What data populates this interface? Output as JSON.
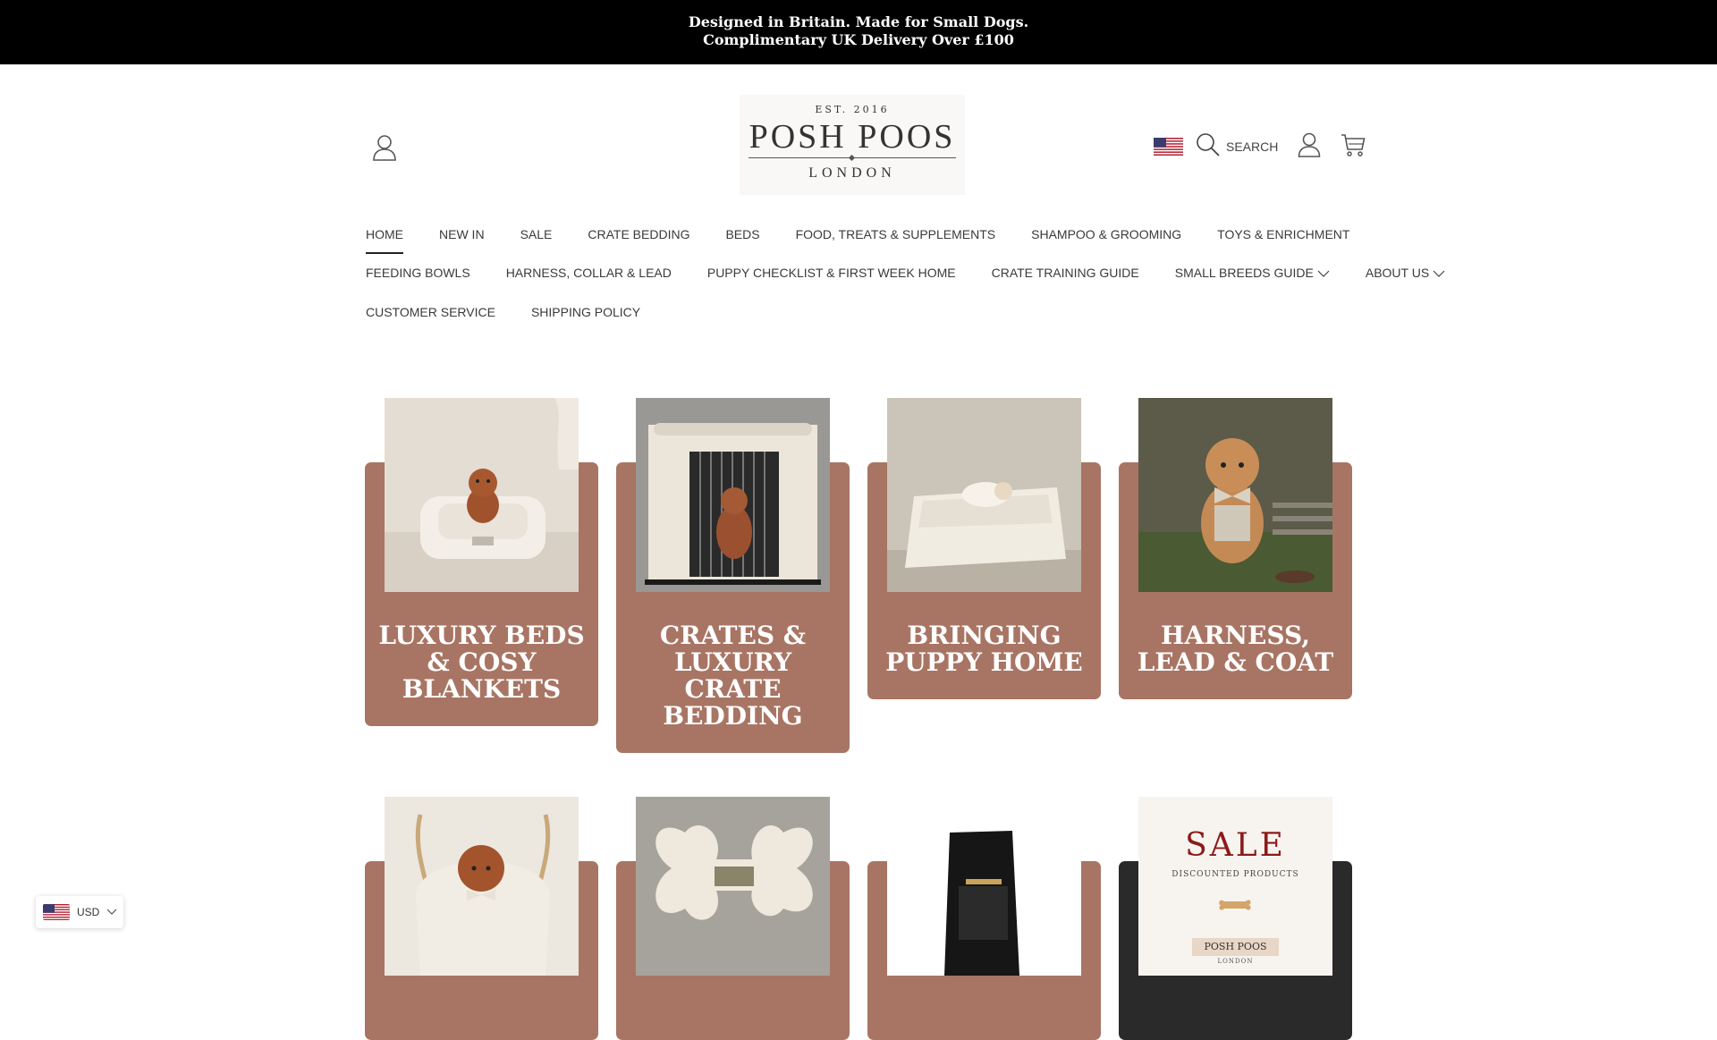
{
  "announcement": {
    "line1": "Designed in Britain. Made for Small Dogs.",
    "line2": "Complimentary UK Delivery Over £100"
  },
  "header": {
    "logo": {
      "est": "EST. 2016",
      "name": "POSH POOS",
      "city": "LONDON"
    },
    "search_label": "SEARCH",
    "icons": [
      "account-icon",
      "flag-us-icon",
      "search-icon",
      "account-icon",
      "cart-icon"
    ]
  },
  "nav": {
    "row1": [
      "HOME",
      "NEW IN",
      "SALE",
      "CRATE BEDDING",
      "BEDS",
      "FOOD, TREATS & SUPPLEMENTS",
      "SHAMPOO & GROOMING",
      "TOYS & ENRICHMENT"
    ],
    "row2": [
      "FEEDING BOWLS",
      "HARNESS, COLLAR & LEAD",
      "PUPPY CHECKLIST & FIRST WEEK HOME",
      "CRATE TRAINING GUIDE",
      "SMALL BREEDS GUIDE",
      "ABOUT US"
    ],
    "row3": [
      "CUSTOMER SERVICE",
      "SHIPPING POLICY"
    ],
    "active": "HOME"
  },
  "categories": [
    {
      "title": [
        "LUXURY BEDS",
        "& COSY",
        "BLANKETS"
      ],
      "image": "puppy-in-cream-bed"
    },
    {
      "title": [
        "CRATES &",
        "LUXURY",
        "CRATE",
        "BEDDING"
      ],
      "image": "puppy-in-crate"
    },
    {
      "title": [
        "BRINGING",
        "PUPPY HOME"
      ],
      "image": "puppy-on-blanket"
    },
    {
      "title": [
        "HARNESS,",
        "LEAD & COAT"
      ],
      "image": "puppy-with-bow-tie"
    },
    {
      "title": [],
      "image": "puppy-in-carrier-bag"
    },
    {
      "title": [],
      "image": "bone-plush-toy"
    },
    {
      "title": [],
      "image": "dog-food-bag"
    },
    {
      "title": [],
      "image": "sale-card",
      "sale": {
        "heading": "SALE",
        "sub": "DISCOUNTED PRODUCTS",
        "brand": "POSH POOS",
        "brand_city": "LONDON"
      }
    }
  ],
  "currency_selector": {
    "code": "USD"
  },
  "colors": {
    "announcement_bg": "#000000",
    "card_bg": "#a87564",
    "card_dark_bg": "#2a2a2a",
    "sale_red": "#8b1a1a"
  }
}
